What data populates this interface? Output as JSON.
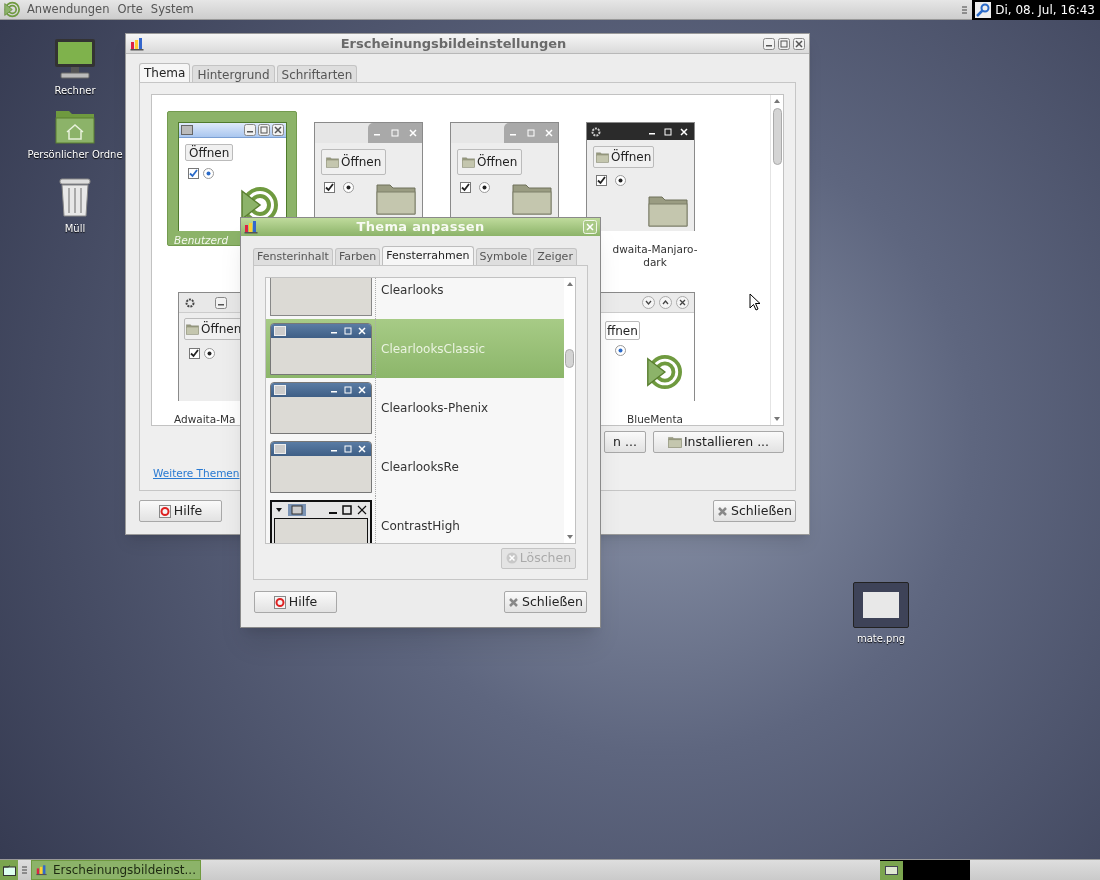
{
  "top_panel": {
    "menus": [
      "Anwendungen",
      "Orte",
      "System"
    ],
    "clock": "Di, 08. Jul, 16:43"
  },
  "desktop_icons": [
    {
      "kind": "computer",
      "label": "Rechner"
    },
    {
      "kind": "home",
      "label": "Persönlicher Ordne"
    },
    {
      "kind": "trash",
      "label": "Müll"
    },
    {
      "kind": "image",
      "label": "mate.png"
    }
  ],
  "main_window": {
    "title": "Erscheinungsbildeinstellungen",
    "tabs": [
      {
        "label": "Thema",
        "selected": true
      },
      {
        "label": "Hintergrund",
        "selected": false
      },
      {
        "label": "Schriftarten",
        "selected": false
      }
    ],
    "theme_rows": [
      [
        {
          "kind": "classic",
          "button": "Öffnen",
          "label": "Benutzerd",
          "selected": true
        },
        {
          "kind": "tabbed",
          "button": "Öffnen",
          "selected": false
        },
        {
          "kind": "tabbed",
          "button": "Öffnen",
          "selected": false
        },
        {
          "kind": "dark",
          "button": "Öffnen",
          "label": "dwaita-Manjaro-dark",
          "selected": false
        }
      ],
      [
        {
          "kind": "gear",
          "button": "Öffnen",
          "label": "Adwaita-Ma",
          "selected": false
        },
        {
          "kind": "rounded",
          "button": "ffnen",
          "label": "BlueMenta",
          "selected": false
        }
      ]
    ],
    "actions": [
      "n ...",
      "Installieren ..."
    ],
    "link": "Weitere Themen",
    "buttons": [
      {
        "kind": "help",
        "label": "Hilfe"
      },
      {
        "kind": "close",
        "label": "Schließen"
      }
    ]
  },
  "dialog": {
    "title": "Thema anpassen",
    "tabs": [
      {
        "label": "Fensterinhalt",
        "selected": false
      },
      {
        "label": "Farben",
        "selected": false
      },
      {
        "label": "Fensterrahmen",
        "selected": true
      },
      {
        "label": "Symbole",
        "selected": false
      },
      {
        "label": "Zeiger",
        "selected": false
      }
    ],
    "frames": [
      {
        "kind": "plain",
        "label": "Clearlooks",
        "selected": false
      },
      {
        "kind": "blue",
        "label": "ClearlooksClassic",
        "selected": true
      },
      {
        "kind": "blue",
        "label": "Clearlooks-Phenix",
        "selected": false
      },
      {
        "kind": "blue",
        "label": "ClearlooksRe",
        "selected": false
      },
      {
        "kind": "contrast",
        "label": "ContrastHigh",
        "selected": false
      }
    ],
    "delete_button": {
      "label": "Löschen",
      "disabled": true
    },
    "buttons": [
      {
        "kind": "help",
        "label": "Hilfe"
      },
      {
        "kind": "close",
        "label": "Schließen"
      }
    ]
  },
  "taskbar": {
    "tasks": [
      {
        "label": "Erscheinungsbildeinst...",
        "selected": true
      }
    ]
  }
}
